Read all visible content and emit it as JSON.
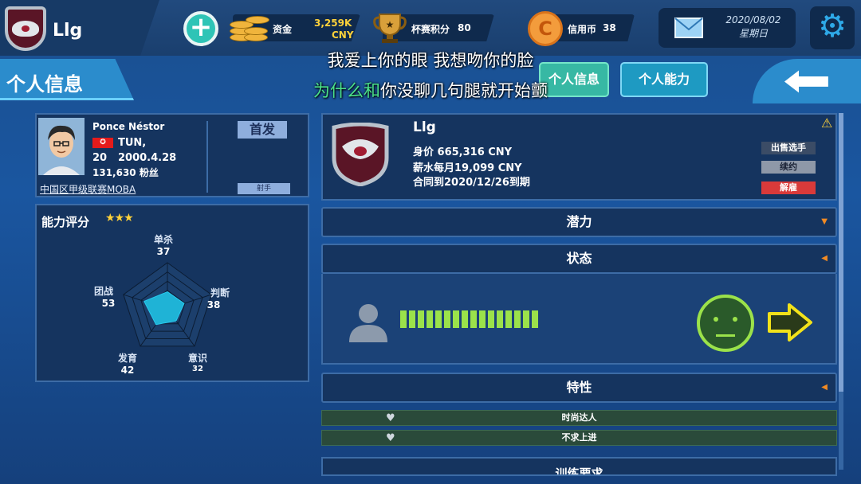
{
  "header": {
    "team_name": "Llg",
    "funds": {
      "label": "资金",
      "value": "3,259K",
      "unit": "CNY"
    },
    "cup_points": {
      "label": "杯赛积分",
      "value": "80"
    },
    "credits": {
      "label": "信用币",
      "value": "38",
      "symbol": "C"
    },
    "date": "2020/08/02",
    "weekday": "星期日"
  },
  "nav": {
    "page_title": "个人信息",
    "tabs": [
      {
        "label": "个人信息",
        "active": true
      },
      {
        "label": "个人能力",
        "active": false
      }
    ]
  },
  "subtitles": {
    "line1": "我爱上你的眼 我想吻你的脸",
    "line2_highlight": "为什么和",
    "line2_rest": "你没聊几句腿就开始颤"
  },
  "player": {
    "name": "Ponce Néstor",
    "flag": "✪",
    "country": "TUN,",
    "age": "20",
    "birth": "2000.4.28",
    "fans": "131,630 粉丝",
    "league": "中国区甲级联赛MOBA",
    "starter_label": "首发",
    "role": "射手"
  },
  "ability": {
    "title": "能力评分",
    "stars": "★★★",
    "stats": [
      {
        "label": "单杀",
        "value": 37
      },
      {
        "label": "判断",
        "value": 38
      },
      {
        "label": "意识",
        "value": 32
      },
      {
        "label": "发育",
        "value": 42
      },
      {
        "label": "团战",
        "value": 53
      }
    ]
  },
  "contract": {
    "team": "Llg",
    "value_line": "身价 665,316 CNY",
    "salary_line": "薪水每月19,099 CNY",
    "expiry_line": "合同到2020/12/26到期",
    "buttons": {
      "sell": "出售选手",
      "renew": "续约",
      "fire": "解雇"
    },
    "warning": "⚠"
  },
  "sections": {
    "potential": "潜力",
    "status": "状态",
    "traits": "特性",
    "next": "训练要求"
  },
  "status": {
    "energy_segments": 16
  },
  "traits": [
    {
      "label": "时尚达人"
    },
    {
      "label": "不求上进"
    }
  ],
  "colors": {
    "accent_green": "#9be24a",
    "fire_red": "#d93a3a",
    "gold": "#ffd23a"
  }
}
